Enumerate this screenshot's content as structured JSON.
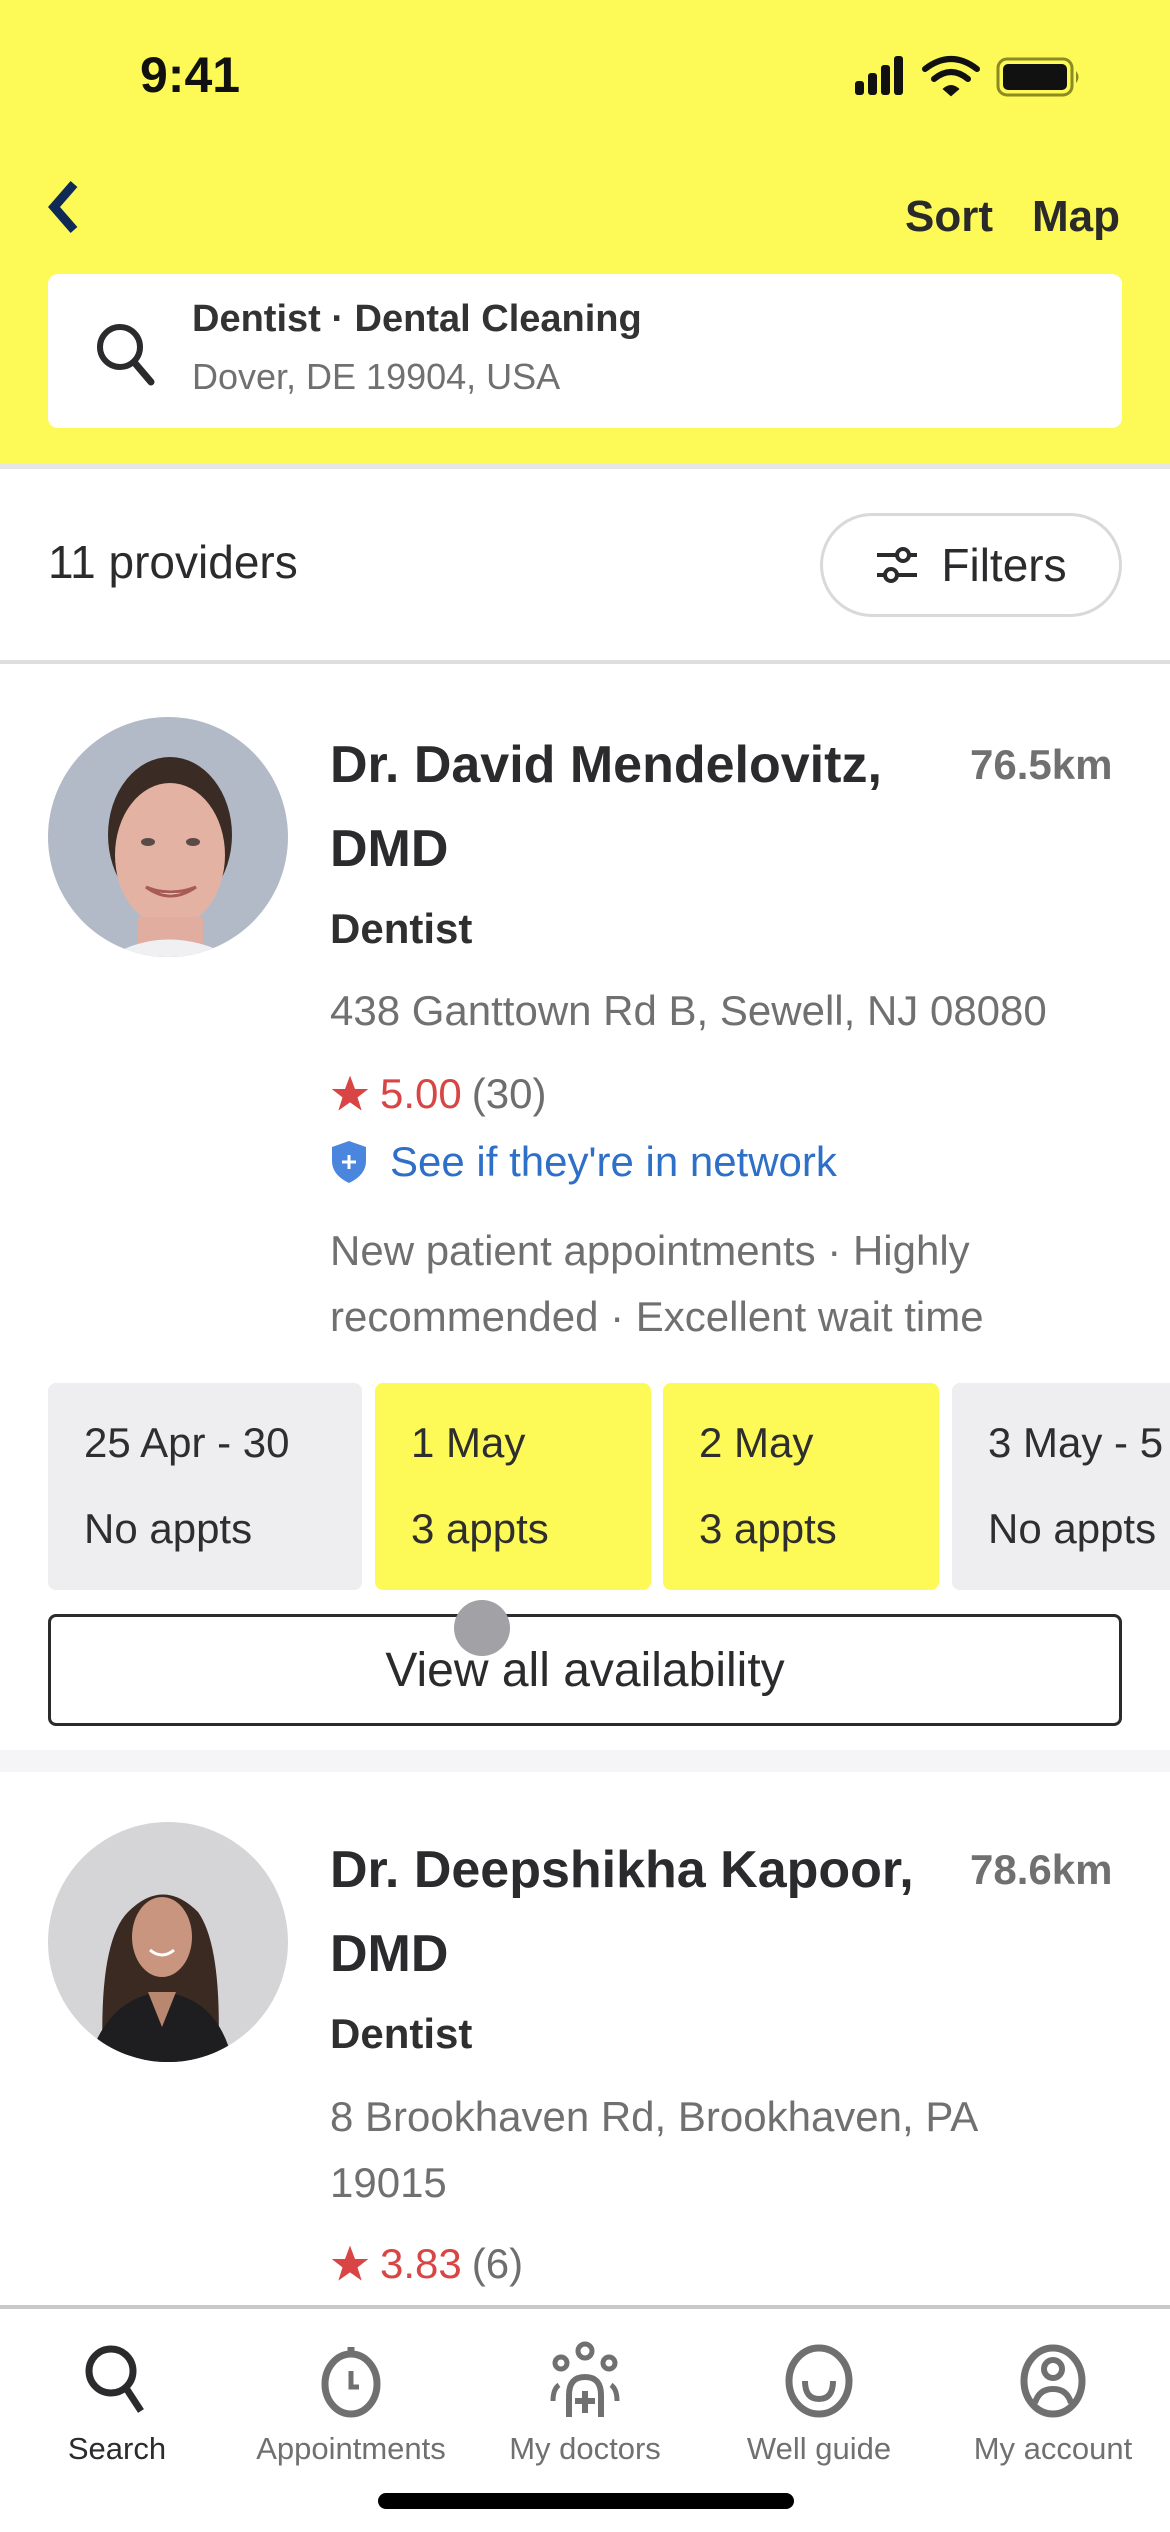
{
  "status_bar": {
    "time": "9:41",
    "icons": [
      "cellular-signal-icon",
      "wifi-icon",
      "battery-icon"
    ]
  },
  "nav": {
    "back_icon": "chevron-left-icon",
    "sort_label": "Sort",
    "map_label": "Map"
  },
  "search": {
    "icon": "search-icon",
    "query": "Dentist · Dental Cleaning",
    "location": "Dover, DE 19904, USA"
  },
  "results": {
    "count_label": "11 providers",
    "filters_label": "Filters",
    "filters_icon": "sliders-icon"
  },
  "providers": [
    {
      "name_line1": "Dr. David Mendelovitz,",
      "name_line2": "DMD",
      "distance": "76.5km",
      "specialty": "Dentist",
      "address": "438 Ganttown Rd B, Sewell, NJ 08080",
      "rating": "5.00",
      "review_count": "(30)",
      "network_link": "See if they're in network",
      "tags": "New patient appointments · Highly recommended · Excellent wait time",
      "slots": [
        {
          "date": "25 Apr - 30",
          "appts": "No appts",
          "available": false
        },
        {
          "date": "1 May",
          "appts": "3 appts",
          "available": true
        },
        {
          "date": "2 May",
          "appts": "3 appts",
          "available": true
        },
        {
          "date": "3 May - 5",
          "appts": "No appts",
          "available": false
        }
      ],
      "view_all_label": "View all availability"
    },
    {
      "name_line1": "Dr. Deepshikha Kapoor,",
      "name_line2": "DMD",
      "distance": "78.6km",
      "specialty": "Dentist",
      "address": "8 Brookhaven Rd, Brookhaven, PA 19015",
      "rating": "3.83",
      "review_count": "(6)"
    }
  ],
  "tabbar": {
    "items": [
      {
        "label": "Search",
        "icon": "search-icon",
        "active": true
      },
      {
        "label": "Appointments",
        "icon": "clock-icon",
        "active": false
      },
      {
        "label": "My doctors",
        "icon": "doctors-group-icon",
        "active": false
      },
      {
        "label": "Well guide",
        "icon": "smile-icon",
        "active": false
      },
      {
        "label": "My account",
        "icon": "user-circle-icon",
        "active": false
      }
    ]
  },
  "colors": {
    "brand_yellow": "#fdf956",
    "rating_red": "#d94545",
    "link_blue": "#2e6fc8",
    "back_navy": "#0f2a55"
  }
}
